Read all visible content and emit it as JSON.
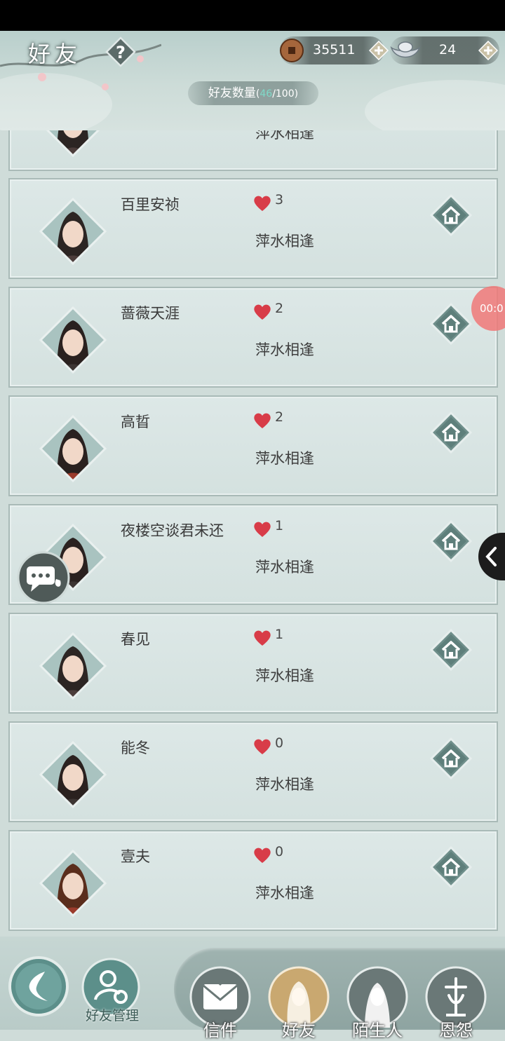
{
  "header": {
    "title": "好友",
    "help_icon": "question-mark-icon",
    "coins": "35511",
    "silver": "24",
    "friend_count_label": "好友数量",
    "friend_count_current": "46",
    "friend_count_max": "/100)",
    "friend_count_open": "("
  },
  "partial_row": {
    "status": "萍水相逢"
  },
  "friends": [
    {
      "name": "百里安祯",
      "hearts": "3",
      "status": "萍水相逢"
    },
    {
      "name": "蔷薇天涯",
      "hearts": "2",
      "status": "萍水相逢"
    },
    {
      "name": "高晢",
      "hearts": "2",
      "status": "萍水相逢"
    },
    {
      "name": "夜楼空谈君未还",
      "hearts": "1",
      "status": "萍水相逢"
    },
    {
      "name": "春见",
      "hearts": "1",
      "status": "萍水相逢"
    },
    {
      "name": "能冬",
      "hearts": "0",
      "status": "萍水相逢"
    },
    {
      "name": "壹夫",
      "hearts": "0",
      "status": "萍水相逢"
    }
  ],
  "bottom": {
    "manage_label": "好友管理",
    "tabs": [
      {
        "label": "信件",
        "icon": "envelope-icon"
      },
      {
        "label": "好友",
        "icon": "friend-portrait-icon"
      },
      {
        "label": "陌生人",
        "icon": "stranger-portrait-icon"
      },
      {
        "label": "恩怨",
        "icon": "grudge-icon"
      }
    ]
  },
  "overlay": {
    "record_timer": "00:0"
  },
  "colors": {
    "heart": "#d83c48",
    "accent_teal": "#7fd9c8",
    "row_bg": "#d8e4e2"
  }
}
